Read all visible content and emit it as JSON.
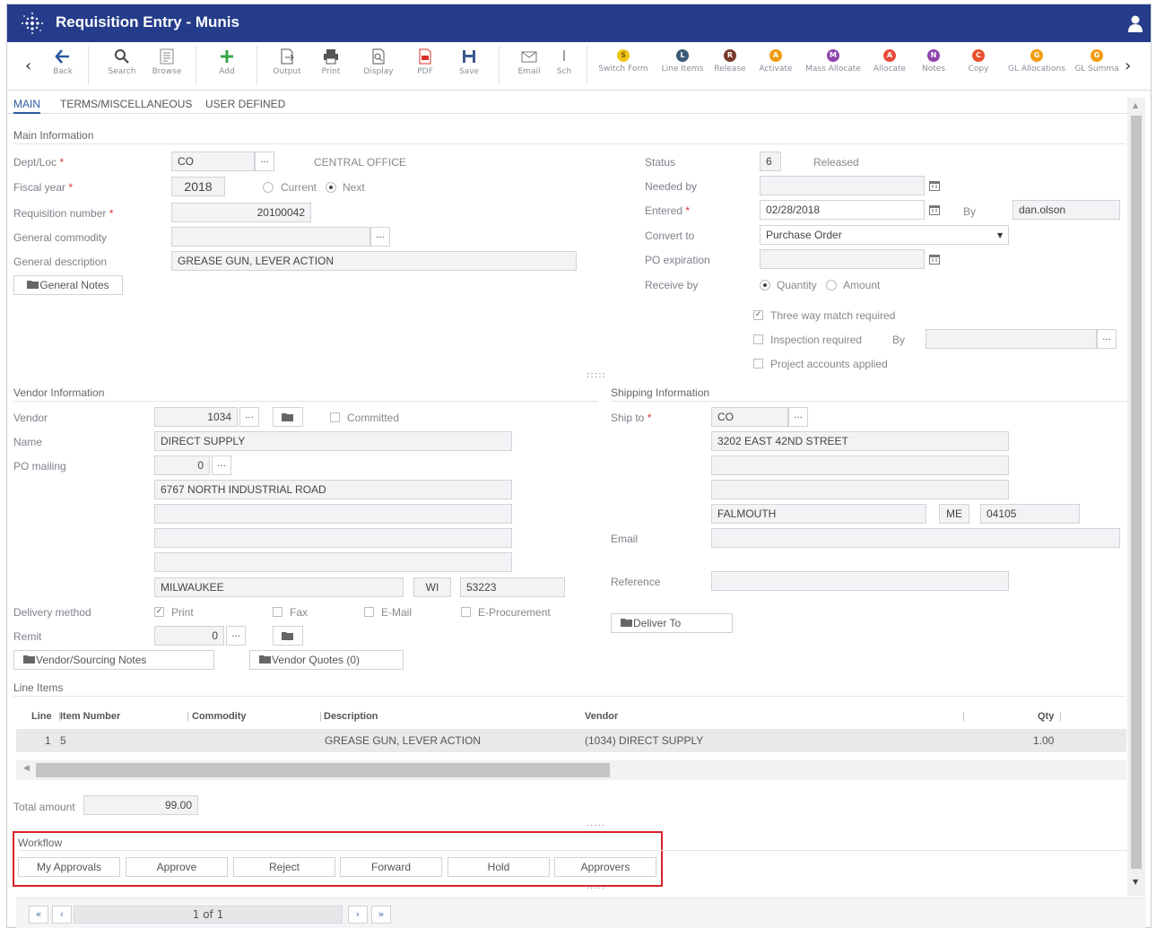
{
  "app": {
    "title": "Requisition Entry - Munis"
  },
  "toolbar": {
    "back": "Back",
    "search": "Search",
    "browse": "Browse",
    "add": "Add",
    "output": "Output",
    "print": "Print",
    "display": "Display",
    "pdf": "PDF",
    "save": "Save",
    "email": "Email",
    "sch": "Sch",
    "actions": [
      {
        "label": "Switch Form",
        "letter": "S",
        "color": "#f0c419"
      },
      {
        "label": "Line Items",
        "letter": "L",
        "color": "#3b5a78"
      },
      {
        "label": "Release",
        "letter": "R",
        "color": "#7a3b2e"
      },
      {
        "label": "Activate",
        "letter": "A",
        "color": "#f39c12"
      },
      {
        "label": "Mass Allocate",
        "letter": "M",
        "color": "#8e44ad"
      },
      {
        "label": "Allocate",
        "letter": "A",
        "color": "#e74c3c"
      },
      {
        "label": "Notes",
        "letter": "N",
        "color": "#8e44ad"
      },
      {
        "label": "Copy",
        "letter": "C",
        "color": "#e8522e"
      },
      {
        "label": "GL Allocations",
        "letter": "G",
        "color": "#f39c12"
      },
      {
        "label": "GL Summa",
        "letter": "G",
        "color": "#f39c12"
      }
    ]
  },
  "tabs": [
    "MAIN",
    "TERMS/MISCELLANEOUS",
    "USER DEFINED"
  ],
  "main": {
    "section": "Main Information",
    "dept_loc_label": "Dept/Loc",
    "dept_loc": "CO",
    "dept_loc_desc": "CENTRAL OFFICE",
    "fiscal_year_label": "Fiscal year",
    "fiscal_year": "2018",
    "current": "Current",
    "next": "Next",
    "req_number_label": "Requisition number",
    "req_number": "20100042",
    "general_commodity_label": "General commodity",
    "general_commodity": "",
    "general_description_label": "General description",
    "general_description": "GREASE GUN, LEVER ACTION",
    "general_notes": "General Notes",
    "status_label": "Status",
    "status_code": "6",
    "status_text": "Released",
    "needed_by_label": "Needed by",
    "needed_by": "",
    "entered_label": "Entered",
    "entered": "02/28/2018",
    "by_label": "By",
    "entered_by": "dan.olson",
    "convert_to_label": "Convert to",
    "convert_to": "Purchase Order",
    "po_expiration_label": "PO expiration",
    "po_expiration": "",
    "receive_by_label": "Receive by",
    "quantity": "Quantity",
    "amount": "Amount",
    "three_way": "Three way match required",
    "inspection": "Inspection required",
    "inspection_by": "By",
    "project_accounts": "Project accounts applied"
  },
  "vendor": {
    "section": "Vendor Information",
    "vendor_label": "Vendor",
    "vendor": "1034",
    "committed": "Committed",
    "name_label": "Name",
    "name": "DIRECT SUPPLY",
    "po_mailing_label": "PO mailing",
    "po_mailing": "0",
    "address1": "6767 NORTH INDUSTRIAL ROAD",
    "city": "MILWAUKEE",
    "state": "WI",
    "zip": "53223",
    "delivery_method_label": "Delivery method",
    "print": "Print",
    "fax": "Fax",
    "email": "E-Mail",
    "eproc": "E-Procurement",
    "remit_label": "Remit",
    "remit": "0",
    "sourcing_notes": "Vendor/Sourcing Notes",
    "quotes": "Vendor Quotes (0)"
  },
  "shipping": {
    "section": "Shipping Information",
    "ship_to_label": "Ship to",
    "ship_to": "CO",
    "address1": "3202 EAST 42ND STREET",
    "city": "FALMOUTH",
    "state": "ME",
    "zip": "04105",
    "email_label": "Email",
    "reference_label": "Reference",
    "deliver_to": "Deliver To"
  },
  "line_items": {
    "section": "Line Items",
    "headers": {
      "line": "Line",
      "item": "Item Number",
      "commodity": "Commodity",
      "description": "Description",
      "vendor": "Vendor",
      "qty": "Qty"
    },
    "rows": [
      {
        "line": "1",
        "item": "5",
        "commodity": "",
        "description": "GREASE GUN, LEVER ACTION",
        "vendor": "(1034) DIRECT SUPPLY",
        "qty": "1.00"
      }
    ]
  },
  "total": {
    "label": "Total amount",
    "value": "99.00"
  },
  "workflow": {
    "section": "Workflow",
    "buttons": [
      "My Approvals",
      "Approve",
      "Reject",
      "Forward",
      "Hold",
      "Approvers"
    ]
  },
  "pager": {
    "text": "1 of 1"
  }
}
